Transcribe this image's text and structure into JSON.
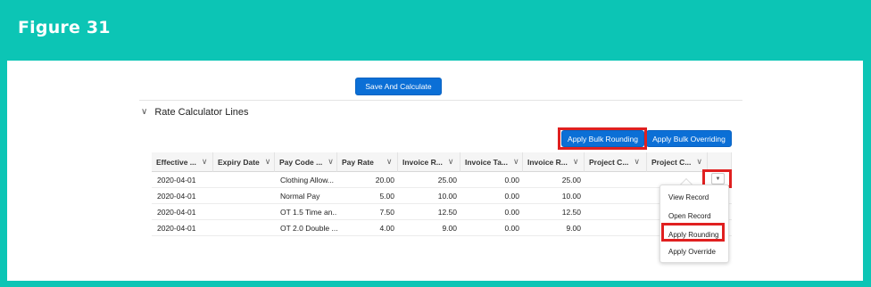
{
  "figure_title": "Figure 31",
  "toolbar": {
    "save_label": "Save And Calculate"
  },
  "section": {
    "chevron": "∨",
    "title": "Rate Calculator Lines"
  },
  "bulk": {
    "rounding_label": "Apply Bulk Rounding",
    "overriding_label": "Apply Bulk Overriding"
  },
  "table": {
    "headers": [
      "Effective ...",
      "Expiry Date",
      "Pay Code ...",
      "Pay Rate",
      "Invoice R...",
      "Invoice Ta...",
      "Invoice R...",
      "Project C...",
      "Project C..."
    ],
    "header_chevron": "∨",
    "rows": [
      [
        "2020-04-01",
        "",
        "Clothing Allow...",
        "20.00",
        "25.00",
        "0.00",
        "25.00",
        "",
        ""
      ],
      [
        "2020-04-01",
        "",
        "Normal Pay",
        "5.00",
        "10.00",
        "0.00",
        "10.00",
        "",
        ""
      ],
      [
        "2020-04-01",
        "",
        "OT 1.5 Time an...",
        "7.50",
        "12.50",
        "0.00",
        "12.50",
        "",
        ""
      ],
      [
        "2020-04-01",
        "",
        "OT 2.0 Double ...",
        "4.00",
        "9.00",
        "0.00",
        "9.00",
        "",
        ""
      ]
    ],
    "row_action_glyph": "▼"
  },
  "row_menu": {
    "items": [
      "View Record",
      "Open Record",
      "Apply Rounding",
      "Apply Override"
    ]
  },
  "colors": {
    "frame": "#0cc5b5",
    "button": "#0b6fd6",
    "highlight": "#e02020"
  }
}
